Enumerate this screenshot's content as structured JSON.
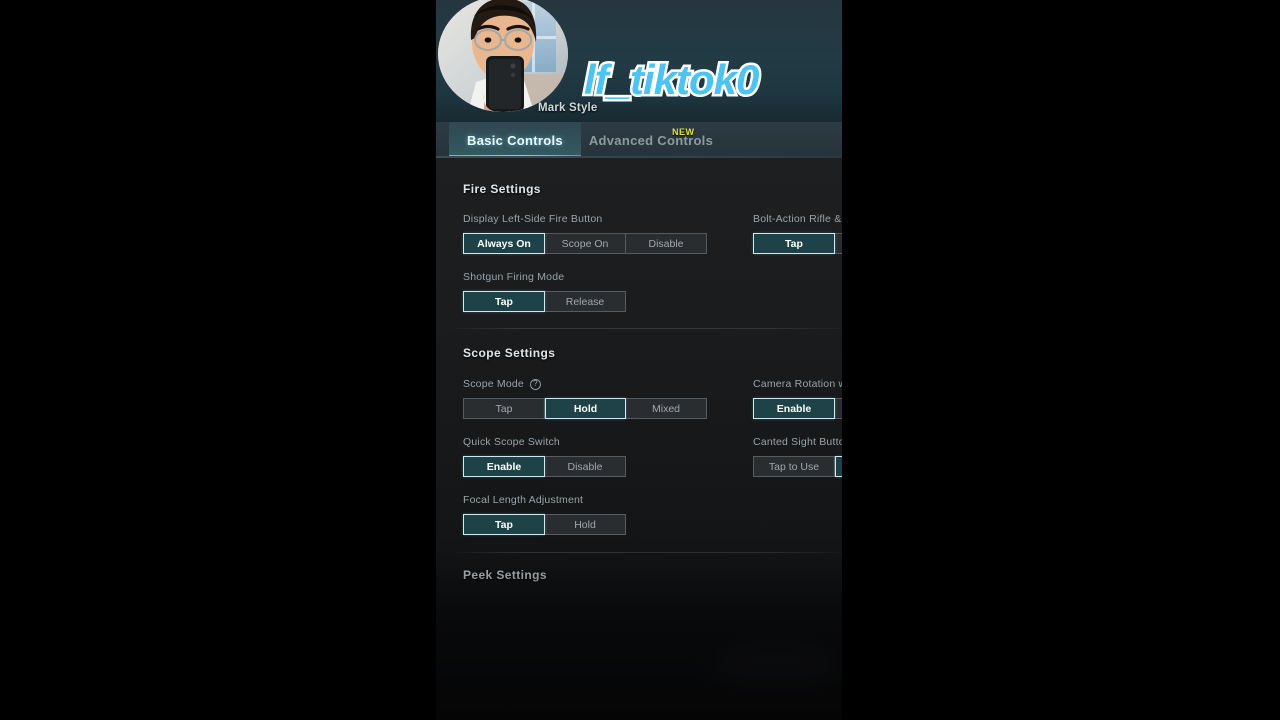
{
  "overlay": {
    "nickname": "lf_tiktok0",
    "avatar_icon": "user-selfie-avatar"
  },
  "header": {
    "title": "Mark Style"
  },
  "tabs": [
    {
      "label": "Basic Controls",
      "active": true
    },
    {
      "label": "Advanced Controls",
      "active": false,
      "badge": "NEW"
    }
  ],
  "sections": [
    {
      "title": "Fire Settings",
      "rows": [
        {
          "label": "Display Left-Side Fire Button",
          "options": [
            "Always On",
            "Scope On",
            "Disable"
          ],
          "selected": "Always On"
        },
        {
          "label": "Bolt-Action Rifle & Cr",
          "options": [
            "Tap"
          ],
          "selected": "Tap"
        },
        {
          "label": "Shotgun Firing Mode",
          "options": [
            "Tap",
            "Release"
          ],
          "selected": "Tap"
        }
      ]
    },
    {
      "title": "Scope Settings",
      "rows": [
        {
          "label": "Scope Mode",
          "help_icon": "question-mark-icon",
          "options": [
            "Tap",
            "Hold",
            "Mixed"
          ],
          "selected": "Hold"
        },
        {
          "label": "Camera Rotation whil",
          "options": [
            "Enable"
          ],
          "selected": "Enable"
        },
        {
          "label": "Quick Scope Switch",
          "options": [
            "Enable",
            "Disable"
          ],
          "selected": "Enable"
        },
        {
          "label": "Canted Sight Button",
          "options": [
            "Tap to Use"
          ],
          "selected": ""
        },
        {
          "label": "Focal Length Adjustment",
          "options": [
            "Tap",
            "Hold"
          ],
          "selected": "Tap"
        }
      ]
    },
    {
      "title": "Peek Settings",
      "rows": []
    }
  ],
  "colors": {
    "accent_teal": "#1d4248",
    "accent_border": "#cfe9ef",
    "tab_underline": "#5fb6c4",
    "badge_new": "#e8e23a",
    "nickname": "#4cc3f0"
  }
}
